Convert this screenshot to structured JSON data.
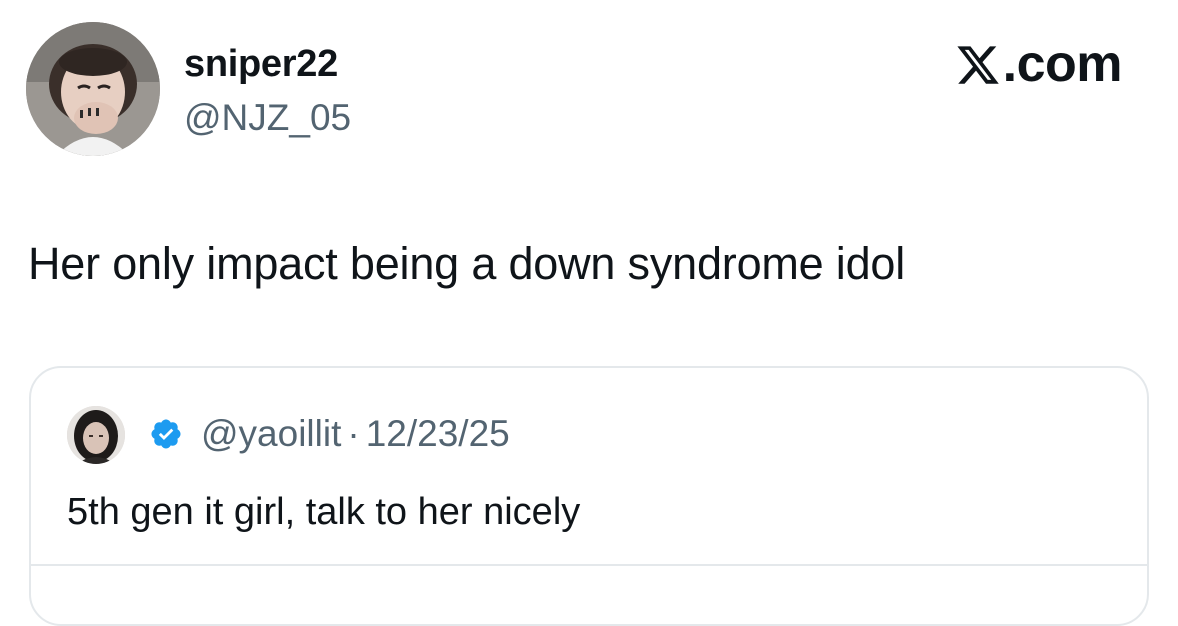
{
  "author": {
    "display_name": "sniper22",
    "handle": "@NJZ_05",
    "avatar": "profile-photo"
  },
  "brand": {
    "label": ".com",
    "icon": "x-logo-icon"
  },
  "tweet": {
    "text": "Her only impact being a down syndrome idol"
  },
  "quoted_tweet": {
    "handle": "@yaoillit",
    "separator": "·",
    "date": "12/23/25",
    "verified_icon": "verified-badge-icon",
    "text": "5th gen it girl, talk to her nicely"
  },
  "colors": {
    "text_primary": "#0f1419",
    "text_secondary": "#536471",
    "border": "#e4e8eb",
    "verified_blue": "#1d9bf0"
  }
}
